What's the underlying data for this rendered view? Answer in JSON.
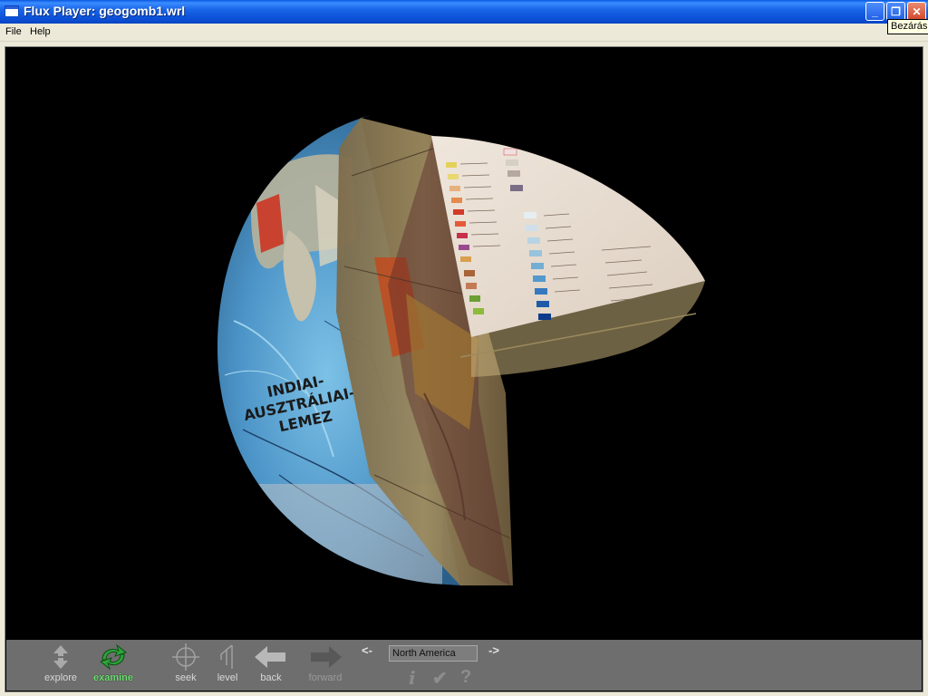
{
  "window": {
    "title": "Flux Player: geogomb1.wrl",
    "close_tooltip": "Bezárás"
  },
  "menu": {
    "file": "File",
    "help": "Help"
  },
  "scene": {
    "plate_label": "INDIAI-\nAUSZTRÁLIAI-\nLEMEZ",
    "plate_lines": [
      "INDIAI-",
      "AUSZTRÁLIAI-",
      "LEMEZ"
    ]
  },
  "toolbar": {
    "explore": "explore",
    "examine": "examine",
    "seek": "seek",
    "level": "level",
    "back": "back",
    "forward": "forward",
    "prev_viewpoint": "<-",
    "next_viewpoint": "->",
    "viewpoint_value": "North America",
    "info_icon": "i",
    "check_icon": "✔",
    "question_icon": "?"
  },
  "colors": {
    "titlebar": "#0b4fd6",
    "examine_active": "#69e06e",
    "toolbar_bg": "#6e6e6e"
  }
}
